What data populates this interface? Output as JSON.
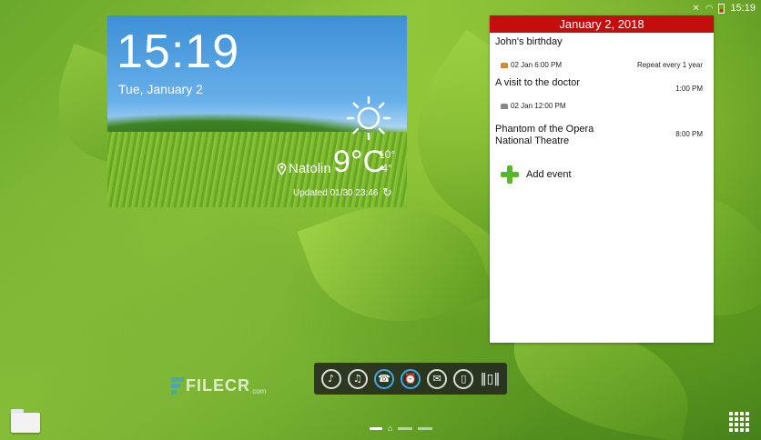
{
  "status_bar": {
    "time": "15:19"
  },
  "weather": {
    "time": "15:19",
    "date": "Tue, January 2",
    "location": "Natolin",
    "temperature": "9°C",
    "high": "10°",
    "low": "4°",
    "updated": "Updated 01/30 23:46",
    "condition_icon": "sun-icon"
  },
  "calendar": {
    "header": "January 2, 2018",
    "events": [
      {
        "title": "John's birthday",
        "date": "02 Jan 6:00 PM",
        "right": "Repeat every 1 year"
      },
      {
        "title": "A visit to the doctor",
        "time": "1:00 PM",
        "date": "02 Jan 12:00 PM"
      },
      {
        "title_line1": "Phantom of the Opera",
        "title_line2": "National Theatre",
        "time": "8:00 PM"
      }
    ],
    "add_label": "Add event"
  },
  "dock": {
    "buttons": [
      "bell-icon",
      "music-icon",
      "phone-icon",
      "alarm-icon",
      "message-icon",
      "mobile-icon",
      "vibrate-icon"
    ],
    "active": [
      "phone-icon",
      "alarm-icon"
    ]
  },
  "watermark": {
    "text": "FILECR",
    "suffix": ".com"
  },
  "colors": {
    "calendar_header": "#c40d0d",
    "accent_blue": "#3fa9e8",
    "add_green": "#57b82a"
  }
}
